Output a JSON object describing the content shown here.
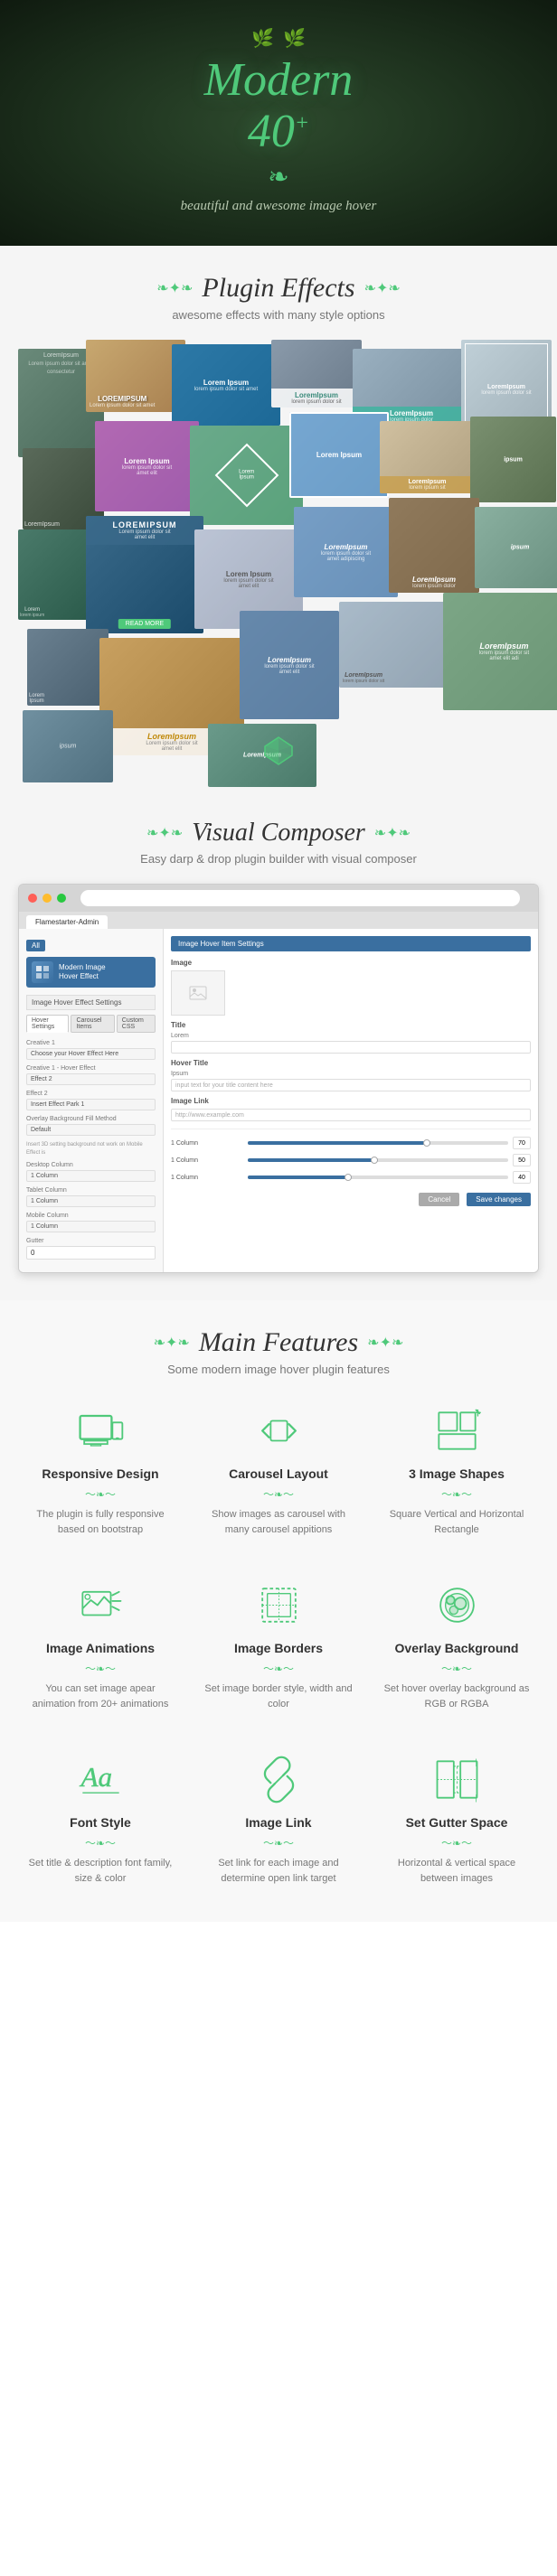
{
  "hero": {
    "title_line1": "Modern",
    "title_line2": "40",
    "title_sup": "+",
    "subtitle": "beautiful and awesome image hover"
  },
  "plugin_effects": {
    "heading": "Plugin Effects",
    "subtext": "awesome effects with many style options"
  },
  "visual_composer": {
    "heading": "Visual Composer",
    "subtext": "Easy darp & drop plugin builder with visual composer",
    "browser": {
      "left_panel": {
        "logo_text_line1": "Modern Image",
        "logo_text_line2": "Hover Effect",
        "settings_label": "Image Hover Effect Settings",
        "tabs": [
          "Hover Settings",
          "Carousel Items",
          "Custom CSS"
        ],
        "fields": [
          {
            "label": "Creative 1",
            "value": "Choose your Hover Effect Here"
          },
          {
            "label": "Creative 1 - Hover Effect",
            "value": ""
          },
          {
            "label": "Effect 2",
            "value": "Insert Effect Park 1"
          },
          {
            "label": "Overlay Background Fill Method",
            "value": "Default"
          },
          {
            "label": "",
            "value": "Insert 3D setting background not work on Mobile Effect is"
          },
          {
            "label": "Desktop Column",
            "value": "1 Column"
          },
          {
            "label": "Tablet Column",
            "value": "1 Column"
          },
          {
            "label": "Mobile Column",
            "value": "1 Column"
          },
          {
            "label": "Gutter",
            "value": "0"
          }
        ]
      },
      "right_panel": {
        "header": "Image Hover Item Settings",
        "sections": [
          {
            "title": "Image",
            "fields": [
              {
                "label": "",
                "value": ""
              }
            ]
          },
          {
            "title": "Title",
            "fields": [
              {
                "label": "Lorem",
                "value": ""
              }
            ]
          },
          {
            "title": "Hover Title",
            "fields": [
              {
                "label": "Ipsum",
                "value": "input text for your title content here"
              }
            ]
          },
          {
            "title": "Image Link",
            "fields": [
              {
                "label": "",
                "value": "http://www.example.com"
              }
            ]
          }
        ],
        "sliders": [
          {
            "label": "1 Column",
            "percent": 70
          },
          {
            "label": "1 Column",
            "percent": 50
          },
          {
            "label": "1 Column",
            "percent": 40
          }
        ],
        "buttons": {
          "cancel": "Cancel",
          "save": "Save changes"
        }
      }
    }
  },
  "main_features": {
    "heading": "Main Features",
    "subtext": "Some modern image hover plugin features",
    "features": [
      {
        "id": "responsive-design",
        "title": "Responsive Design",
        "desc": "The plugin is fully responsive based on bootstrap",
        "icon": "responsive"
      },
      {
        "id": "carousel-layout",
        "title": "Carousel Layout",
        "desc": "Show images as carousel with many carousel appitions",
        "icon": "carousel"
      },
      {
        "id": "image-shapes",
        "title": "3 Image Shapes",
        "desc": "Square Vertical and Horizontal Rectangle",
        "icon": "shapes"
      },
      {
        "id": "image-animations",
        "title": "Image Animations",
        "desc": "You can set image apear animation from 20+ animations",
        "icon": "animations"
      },
      {
        "id": "image-borders",
        "title": "Image Borders",
        "desc": "Set image border style, width and color",
        "icon": "borders"
      },
      {
        "id": "overlay-background",
        "title": "Overlay Background",
        "desc": "Set hover overlay background as RGB or RGBA",
        "icon": "overlay"
      },
      {
        "id": "font-style",
        "title": "Font Style",
        "desc": "Set title & description font family, size & color",
        "icon": "font"
      },
      {
        "id": "image-link",
        "title": "Image Link",
        "desc": "Set link for each image and determine open link target",
        "icon": "link"
      },
      {
        "id": "set-gutter-space",
        "title": "Set Gutter Space",
        "desc": "Horizontal & vertical space between images",
        "icon": "gutter"
      }
    ]
  },
  "ornaments": {
    "leaf": "❧",
    "wave": "〜❧〜",
    "divider": "✦✦✦"
  }
}
